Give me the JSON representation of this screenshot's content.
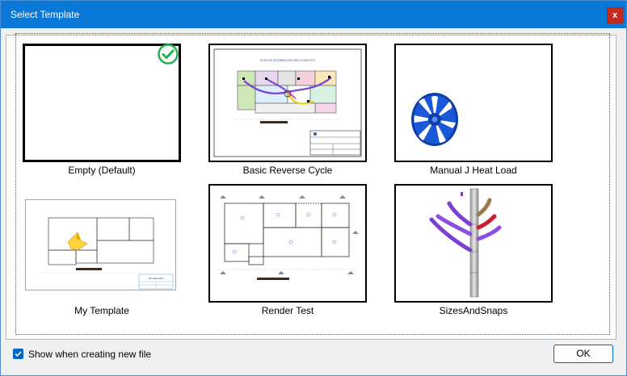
{
  "window": {
    "title": "Select Template",
    "close_label": "x"
  },
  "templates": [
    {
      "name": "Empty (Default)",
      "selected": true
    },
    {
      "name": "Basic Reverse Cycle",
      "selected": false
    },
    {
      "name": "Manual J Heat Load",
      "selected": false
    },
    {
      "name": "My Template",
      "selected": false
    },
    {
      "name": "Render Test",
      "selected": false
    },
    {
      "name": "SizesAndSnaps",
      "selected": false
    }
  ],
  "footer": {
    "checkbox_label": "Show when creating new file",
    "checkbox_checked": true,
    "ok_label": "OK"
  },
  "colors": {
    "titlebar": "#0a78d7",
    "close": "#c42b1c",
    "check_green": "#22b14c",
    "accent": "#0067c0"
  },
  "icons": {
    "selected_badge": "check-circle-icon",
    "checkbox": "checkmark-icon"
  }
}
